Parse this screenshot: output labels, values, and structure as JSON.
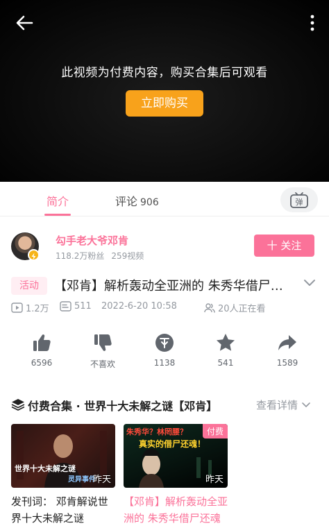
{
  "player": {
    "paywall_message": "此视频为付费内容，购买合集后可观看",
    "buy_label": "立即购买"
  },
  "tabs": {
    "intro": "简介",
    "comments": "评论",
    "comments_count": "906",
    "danmaku_icon_text": "弹"
  },
  "uploader": {
    "name": "勾手老大爷邓肯",
    "followers": "118.2万粉丝",
    "videos": "259视频",
    "follow_label": "十 关注"
  },
  "video": {
    "tag": "活动",
    "title": "【邓肯】解析轰动全亚洲的 朱秀华借尸还魂案",
    "views": "1.2万",
    "danmaku": "511",
    "date": "2022-6-20 10:58",
    "watching": "20人正在看"
  },
  "actions": [
    {
      "label": "6596",
      "icon": "thumbs-up-icon"
    },
    {
      "label": "不喜欢",
      "icon": "thumbs-down-icon"
    },
    {
      "label": "1138",
      "icon": "coin-icon"
    },
    {
      "label": "541",
      "icon": "star-icon"
    },
    {
      "label": "1589",
      "icon": "share-icon"
    }
  ],
  "collection": {
    "title": "付费合集 · 世界十大未解之谜【邓肯】",
    "detail_label": "查看详情",
    "cards": [
      {
        "title": "发刊词： 邓肯解说世界十大未解之谜",
        "time": "昨天",
        "thumb_text": "世界十大未解之谜",
        "thumb_sub": "灵异事件"
      },
      {
        "title": "【邓肯】解析轰动全亚洲的 朱秀华借尸还魂案",
        "time": "昨天",
        "badge": "付费",
        "thumb_text_1": "朱秀华？林罔腰？",
        "thumb_text_2": "真实的借尸还魂！"
      }
    ]
  },
  "colors": {
    "accent": "#fb7299",
    "buy": "#f8a21b",
    "muted": "#9499a0"
  }
}
